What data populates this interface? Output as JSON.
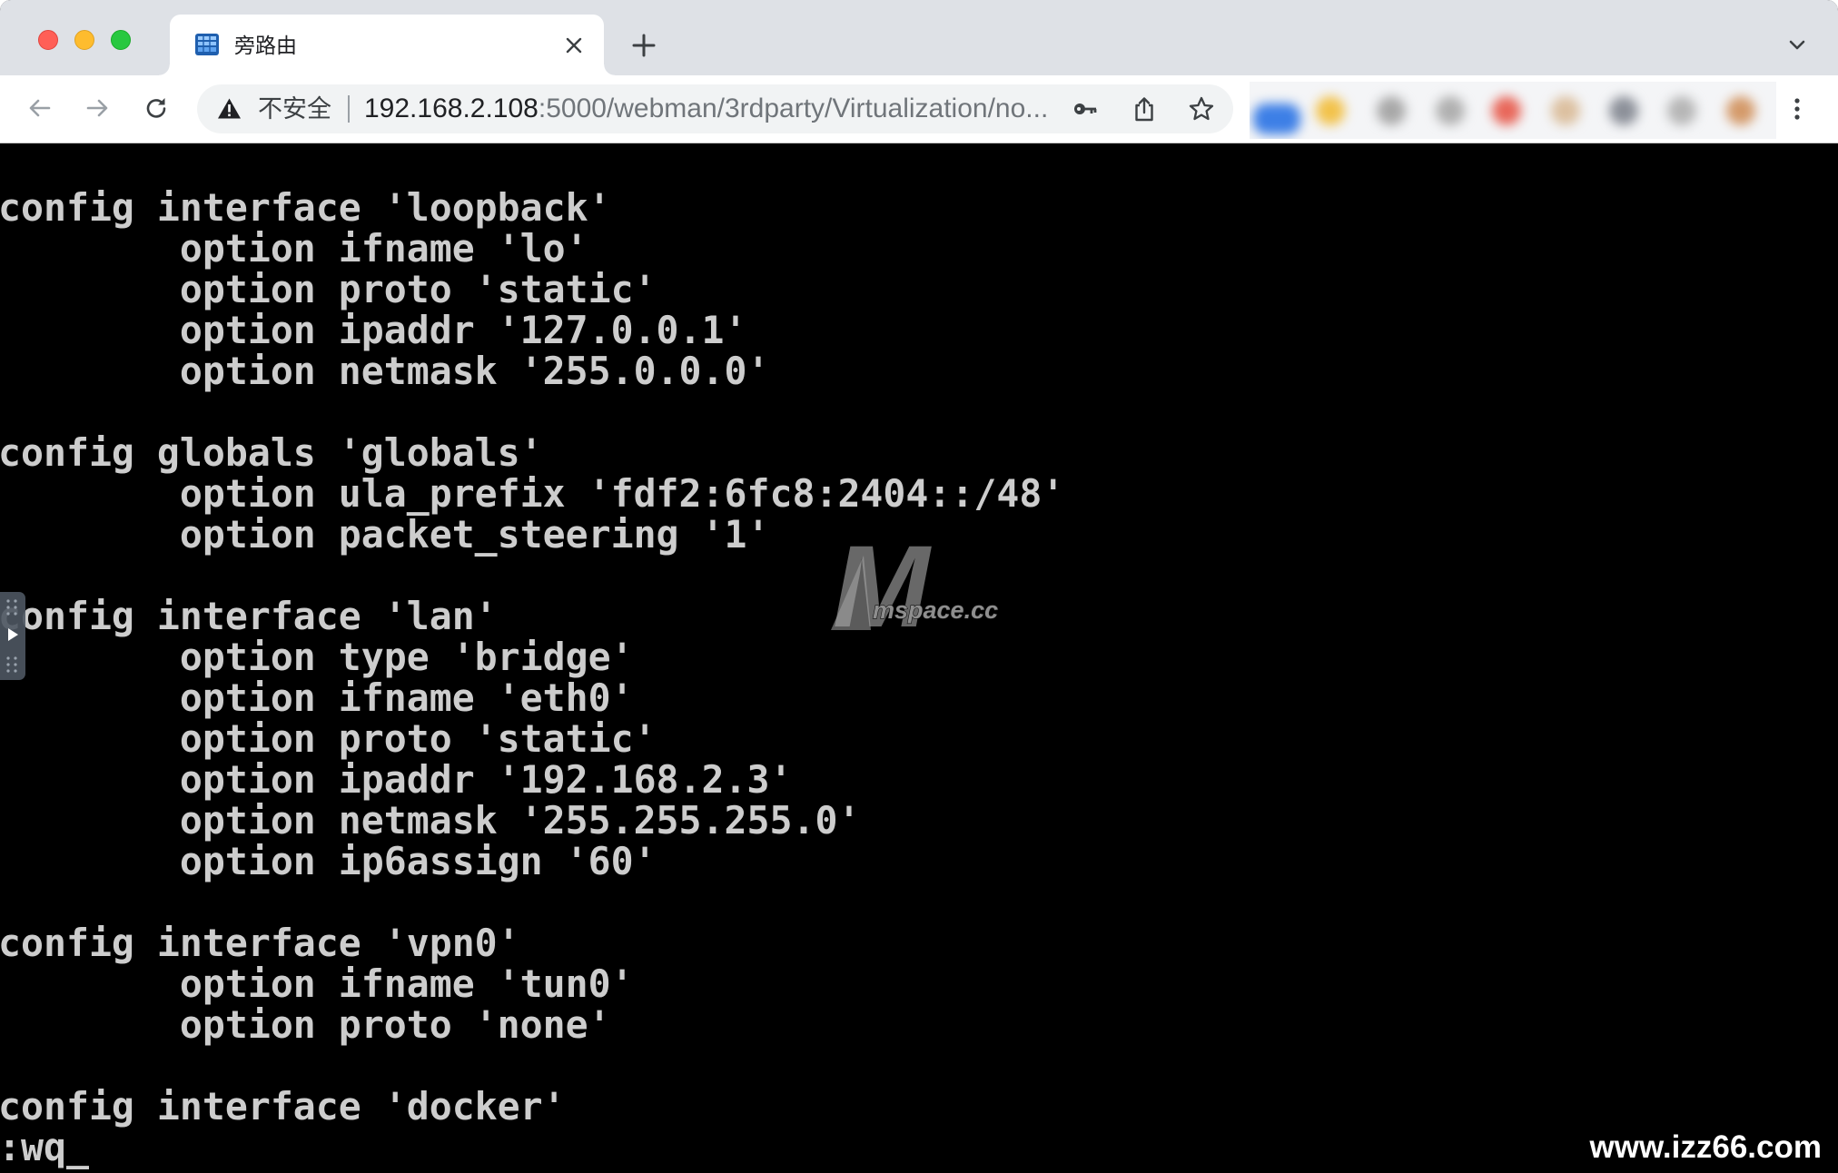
{
  "theme": {
    "tab_strip": "#dee1e6",
    "toolbar": "#ffffff",
    "address_bar": "#f1f3f4",
    "terminal_bg": "#000000",
    "terminal_fg": "#cdcdcd",
    "traffic_close": "#ff5f57",
    "traffic_minimize": "#febc2e",
    "traffic_maximize": "#28c840"
  },
  "window_controls": {
    "close_icon": "close-window-icon",
    "minimize_icon": "minimize-window-icon",
    "maximize_icon": "maximize-window-icon"
  },
  "tab": {
    "title": "旁路由",
    "favicon": "virtualization-app-icon",
    "close_icon": "close-icon"
  },
  "tab_strip": {
    "new_tab_icon": "plus-icon",
    "tab_search_icon": "chevron-down-icon"
  },
  "toolbar": {
    "back_icon": "arrow-left-icon",
    "forward_icon": "arrow-right-icon",
    "reload_icon": "reload-icon",
    "menu_icon": "more-vertical-icon"
  },
  "address_bar": {
    "security_icon": "warning-triangle-icon",
    "security_label": "不安全",
    "url_host": "192.168.2.108",
    "url_path": ":5000/webman/3rdparty/Virtualization/no...",
    "password_icon": "key-icon",
    "share_icon": "share-icon",
    "bookmark_icon": "star-icon"
  },
  "extensions": {
    "icon_colors": [
      "#3d7fe6",
      "#f2c24b",
      "#a8a8a8",
      "#b0b0b0",
      "#e8675a",
      "#dcc0a0",
      "#8c9099",
      "#b6b6b6",
      "#d49a6a"
    ]
  },
  "terminal": {
    "lines": [
      "config interface 'loopback'",
      "option ifname 'lo'",
      "option proto 'static'",
      "option ipaddr '127.0.0.1'",
      "option netmask '255.0.0.0'",
      "",
      "config globals 'globals'",
      "option ula_prefix 'fdf2:6fc8:2404::/48'",
      "option packet_steering '1'",
      "",
      "config interface 'lan'",
      "option type 'bridge'",
      "option ifname 'eth0'",
      "option proto 'static'",
      "option ipaddr '192.168.2.3'",
      "option netmask '255.255.255.0'",
      "option ip6assign '60'",
      "",
      "config interface 'vpn0'",
      "option ifname 'tun0'",
      "option proto 'none'",
      "",
      "config interface 'docker'"
    ],
    "command": ":wq",
    "cursor": "_"
  },
  "side_panel_toggle": {
    "icon": "play-icon"
  },
  "watermarks": {
    "logo_letter": "M",
    "logo_text": "mspace.cc",
    "corner_text": "www.izz66.com"
  }
}
